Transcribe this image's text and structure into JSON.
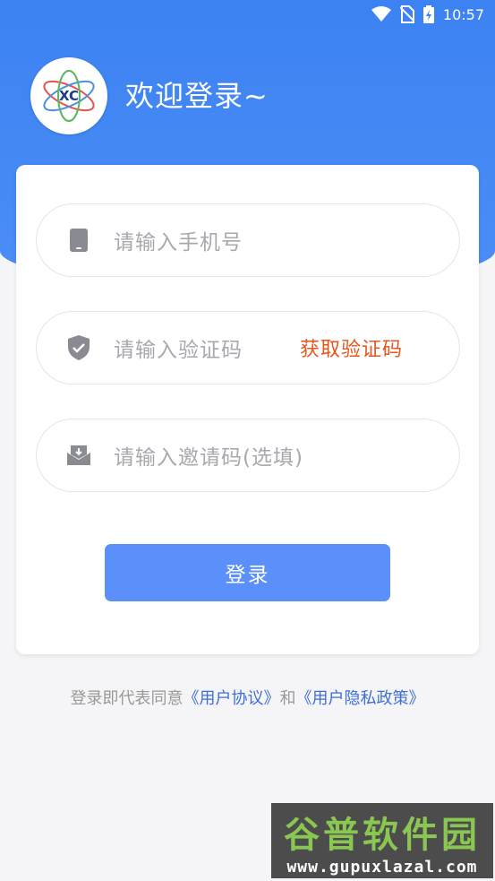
{
  "status_bar": {
    "time": "10:57",
    "icons": [
      "wifi-icon",
      "no-sim-icon",
      "battery-charging-icon"
    ]
  },
  "header": {
    "welcome_text": "欢迎登录~",
    "logo_icon": "app-logo-icon"
  },
  "form": {
    "phone": {
      "placeholder": "请输入手机号",
      "icon": "phone-icon"
    },
    "code": {
      "placeholder": "请输入验证码",
      "icon": "shield-icon",
      "get_code_label": "获取验证码"
    },
    "invite": {
      "placeholder": "请输入邀请码(选填)",
      "icon": "mail-icon"
    },
    "login_label": "登录"
  },
  "agreement": {
    "prefix": "登录即代表同意",
    "user_agreement": "《用户协议》",
    "and": "和",
    "privacy_policy": "《用户隐私政策》"
  },
  "watermark": {
    "title": "谷普软件园",
    "url": "www.gupuxlazal.com"
  },
  "colors": {
    "primary": "#3c82f2",
    "button": "#5b8ff9",
    "accent_orange": "#e8541c",
    "link": "#3c6fd8"
  }
}
